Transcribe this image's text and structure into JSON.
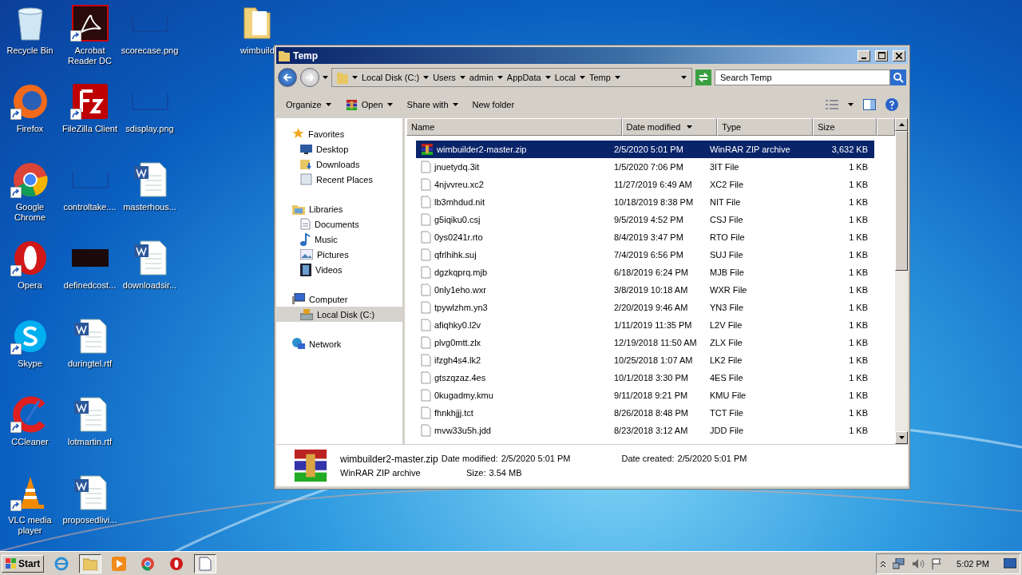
{
  "desktop": {
    "columns": [
      [
        {
          "label": "Recycle Bin",
          "kind": "recycle",
          "shortcut": false
        },
        {
          "label": "Firefox",
          "kind": "firefox",
          "shortcut": true
        },
        {
          "label": "Google Chrome",
          "kind": "chrome",
          "shortcut": true
        },
        {
          "label": "Opera",
          "kind": "opera",
          "shortcut": true
        },
        {
          "label": "Skype",
          "kind": "skype",
          "shortcut": true
        },
        {
          "label": "CCleaner",
          "kind": "ccleaner",
          "shortcut": true
        },
        {
          "label": "VLC media player",
          "kind": "vlc",
          "shortcut": true
        }
      ],
      [
        {
          "label": "Acrobat Reader DC",
          "kind": "acrobat",
          "shortcut": true
        },
        {
          "label": "FileZilla Client",
          "kind": "filezilla",
          "shortcut": true
        },
        {
          "label": "controltake....",
          "kind": "image",
          "shortcut": false
        },
        {
          "label": "definedcost...",
          "kind": "black",
          "shortcut": false
        },
        {
          "label": "duringtel.rtf",
          "kind": "word",
          "shortcut": false
        },
        {
          "label": "lotmartin.rtf",
          "kind": "word",
          "shortcut": false
        },
        {
          "label": "proposedlivi...",
          "kind": "word",
          "shortcut": false
        }
      ],
      [
        {
          "label": "scorecase.png",
          "kind": "image",
          "shortcut": false
        },
        {
          "label": "sdisplay.png",
          "kind": "image",
          "shortcut": false
        },
        {
          "label": "masterhous...",
          "kind": "word",
          "shortcut": false
        },
        {
          "label": "downloadsir...",
          "kind": "word",
          "shortcut": false
        }
      ],
      [
        {
          "label": "wimbuild",
          "kind": "folder",
          "shortcut": false
        }
      ]
    ]
  },
  "window": {
    "title": "Temp",
    "address": [
      "Local Disk (C:)",
      "Users",
      "admin",
      "AppData",
      "Local",
      "Temp"
    ],
    "search": {
      "placeholder": "Search Temp"
    },
    "toolbar": [
      {
        "label": "Organize",
        "kind": "menu"
      },
      {
        "label": "Open",
        "kind": "open"
      },
      {
        "label": "Share with",
        "kind": "menu"
      },
      {
        "label": "New folder",
        "kind": "plain"
      }
    ],
    "nav": [
      {
        "label": "Favorites",
        "kind": "favorites",
        "selected": false,
        "children": [
          {
            "label": "Desktop",
            "kind": "desktop",
            "selected": false
          },
          {
            "label": "Downloads",
            "kind": "downloads",
            "selected": false
          },
          {
            "label": "Recent Places",
            "kind": "recent",
            "selected": false
          }
        ]
      },
      {
        "label": "Libraries",
        "kind": "libraries",
        "selected": false,
        "children": [
          {
            "label": "Documents",
            "kind": "documents",
            "selected": false
          },
          {
            "label": "Music",
            "kind": "music",
            "selected": false
          },
          {
            "label": "Pictures",
            "kind": "pictures",
            "selected": false
          },
          {
            "label": "Videos",
            "kind": "videos",
            "selected": false
          }
        ]
      },
      {
        "label": "Computer",
        "kind": "computer",
        "selected": false,
        "children": [
          {
            "label": "Local Disk (C:)",
            "kind": "disk",
            "selected": true
          }
        ]
      },
      {
        "label": "Network",
        "kind": "network",
        "selected": false
      }
    ],
    "columns": [
      "Name",
      "Date modified",
      "Type",
      "Size"
    ],
    "rows": [
      {
        "name": "wimbuilder2-master.zip",
        "date": "2/5/2020 5:01 PM",
        "type": "WinRAR ZIP archive",
        "size": "3,632 KB",
        "kind": "archive",
        "selected": true
      },
      {
        "name": "jnuetydq.3it",
        "date": "1/5/2020 7:06 PM",
        "type": "3IT File",
        "size": "1 KB",
        "kind": "file",
        "selected": false
      },
      {
        "name": "4njvvreu.xc2",
        "date": "11/27/2019 6:49 AM",
        "type": "XC2 File",
        "size": "1 KB",
        "kind": "file",
        "selected": false
      },
      {
        "name": "lb3mhdud.nit",
        "date": "10/18/2019 8:38 PM",
        "type": "NIT File",
        "size": "1 KB",
        "kind": "file",
        "selected": false
      },
      {
        "name": "g5iqiku0.csj",
        "date": "9/5/2019 4:52 PM",
        "type": "CSJ File",
        "size": "1 KB",
        "kind": "file",
        "selected": false
      },
      {
        "name": "0ys0241r.rto",
        "date": "8/4/2019 3:47 PM",
        "type": "RTO File",
        "size": "1 KB",
        "kind": "file",
        "selected": false
      },
      {
        "name": "qfrlhihk.suj",
        "date": "7/4/2019 6:56 PM",
        "type": "SUJ File",
        "size": "1 KB",
        "kind": "file",
        "selected": false
      },
      {
        "name": "dgzkqprq.mjb",
        "date": "6/18/2019 6:24 PM",
        "type": "MJB File",
        "size": "1 KB",
        "kind": "file",
        "selected": false
      },
      {
        "name": "0nly1eho.wxr",
        "date": "3/8/2019 10:18 AM",
        "type": "WXR File",
        "size": "1 KB",
        "kind": "file",
        "selected": false
      },
      {
        "name": "tpywlzhm.yn3",
        "date": "2/20/2019 9:46 AM",
        "type": "YN3 File",
        "size": "1 KB",
        "kind": "file",
        "selected": false
      },
      {
        "name": "afiqhky0.l2v",
        "date": "1/11/2019 11:35 PM",
        "type": "L2V File",
        "size": "1 KB",
        "kind": "file",
        "selected": false
      },
      {
        "name": "plvg0mtt.zlx",
        "date": "12/19/2018 11:50 AM",
        "type": "ZLX File",
        "size": "1 KB",
        "kind": "file",
        "selected": false
      },
      {
        "name": "ifzgh4s4.lk2",
        "date": "10/25/2018 1:07 AM",
        "type": "LK2 File",
        "size": "1 KB",
        "kind": "file",
        "selected": false
      },
      {
        "name": "gtszqzaz.4es",
        "date": "10/1/2018 3:30 PM",
        "type": "4ES File",
        "size": "1 KB",
        "kind": "file",
        "selected": false
      },
      {
        "name": "0kugadmy.kmu",
        "date": "9/11/2018 9:21 PM",
        "type": "KMU File",
        "size": "1 KB",
        "kind": "file",
        "selected": false
      },
      {
        "name": "fhnkhjjj.tct",
        "date": "8/26/2018 8:48 PM",
        "type": "TCT File",
        "size": "1 KB",
        "kind": "file",
        "selected": false
      },
      {
        "name": "mvw33u5h.jdd",
        "date": "8/23/2018 3:12 AM",
        "type": "JDD File",
        "size": "1 KB",
        "kind": "file",
        "selected": false
      }
    ],
    "details": {
      "name": "wimbuilder2-master.zip",
      "type": "WinRAR ZIP archive",
      "modified_label": "Date modified:",
      "modified": "2/5/2020 5:01 PM",
      "size_label": "Size:",
      "size": "3.54 MB",
      "created_label": "Date created:",
      "created": "2/5/2020 5:01 PM"
    }
  },
  "taskbar": {
    "start": "Start",
    "apps": [
      {
        "kind": "ie",
        "selected": false
      },
      {
        "kind": "explorer",
        "selected": true
      },
      {
        "kind": "media",
        "selected": false
      },
      {
        "kind": "chrome",
        "selected": false
      },
      {
        "kind": "opera",
        "selected": false
      },
      {
        "kind": "notepad",
        "selected": true
      }
    ],
    "clock": "5:02 PM"
  }
}
